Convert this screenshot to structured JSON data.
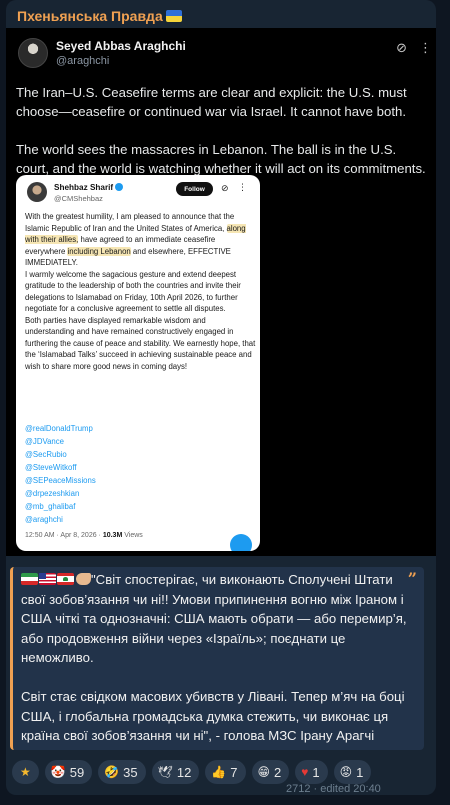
{
  "channel": {
    "name": "Пхеньянська Правда"
  },
  "tweet": {
    "author_name": "Seyed Abbas Araghchi",
    "author_handle": "@araghchi",
    "paragraphs": [
      "The Iran–U.S. Ceasefire terms are clear and explicit: the U.S. must choose—ceasefire or continued war via Israel. It cannot have both.",
      "The world sees the massacres in Lebanon. The ball is in the U.S. court, and the world is watching whether it will act on its commitments."
    ],
    "icons": [
      "grok-icon",
      "more-icon"
    ]
  },
  "quoted_tweet": {
    "author_name": "Shehbaz Sharif",
    "author_handle": "@CMShehbaz",
    "follow_label": "Follow",
    "text_1a": "With the greatest humility, I am pleased to announce that the Islamic Republic of Iran and the United States of America, ",
    "text_1hl": "along with their allies,",
    "text_1b": " have agreed to an immediate ceasefire everywhere ",
    "text_1hl2": "including Lebanon",
    "text_1c": " and elsewhere, EFFECTIVE IMMEDIATELY.",
    "text_2": "I warmly welcome the sagacious gesture and extend deepest gratitude to the leadership of both the countries and invite their delegations to Islamabad on Friday, 10th April 2026, to further negotiate for a conclusive agreement to settle all disputes.",
    "text_3": "Both parties have displayed remarkable wisdom and understanding and have remained constructively engaged in furthering the cause of peace and stability. We earnestly hope, that the ‘Islamabad Talks’ succeed in achieving sustainable peace and wish to share more good news in coming days!",
    "mentions": [
      "@realDonaldTrump",
      "@JDVance",
      "@SecRubio",
      "@SteveWitkoff",
      "@SEPeaceMissions",
      "@drpezeshkian",
      "@mb_ghalibaf",
      "@araghchi"
    ],
    "timestamp": "12:50 AM · Apr 8, 2026 · ",
    "views_count": "10.3M",
    "views_label": " Views"
  },
  "caption": {
    "line": "\"Світ спостерігає, чи виконають Сполучені Штати свої зобов’язання чи ні!! Умови припинення вогню між Іраном і США чіткі та однозначні: США мають обрати — або перемир’я, або продовження війни через «Ізраїль»; поєднати це неможливо.",
    "line2": "Світ стає свідком масових убивств у Лівані. Тепер м’яч на боці США, і глобальна громадська думка стежить, чи виконає ця країна свої зобов’язання чи ні\", - голова МЗС Ірану Арагчі"
  },
  "reactions": [
    {
      "icon": "star-icon",
      "glyph": "★",
      "count": ""
    },
    {
      "icon": "clown-icon",
      "glyph": "🤡",
      "count": "59"
    },
    {
      "icon": "rofl-icon",
      "glyph": "🤣",
      "count": "35"
    },
    {
      "icon": "dove-icon",
      "glyph": "🕊",
      "count": "12"
    },
    {
      "icon": "thumbs-up-icon",
      "glyph": "👍",
      "count": "7"
    },
    {
      "icon": "grin-icon",
      "glyph": "😁",
      "count": "2"
    },
    {
      "icon": "heart-icon",
      "glyph": "♥",
      "count": "1"
    },
    {
      "icon": "angry-icon",
      "glyph": "😡",
      "count": "1"
    }
  ],
  "meta": {
    "views_time": "2712 · edited 20:40"
  },
  "colors": {
    "background": "#0e1621",
    "bubble": "#182533",
    "accent": "#f0a152",
    "link": "#1d9bf0"
  }
}
